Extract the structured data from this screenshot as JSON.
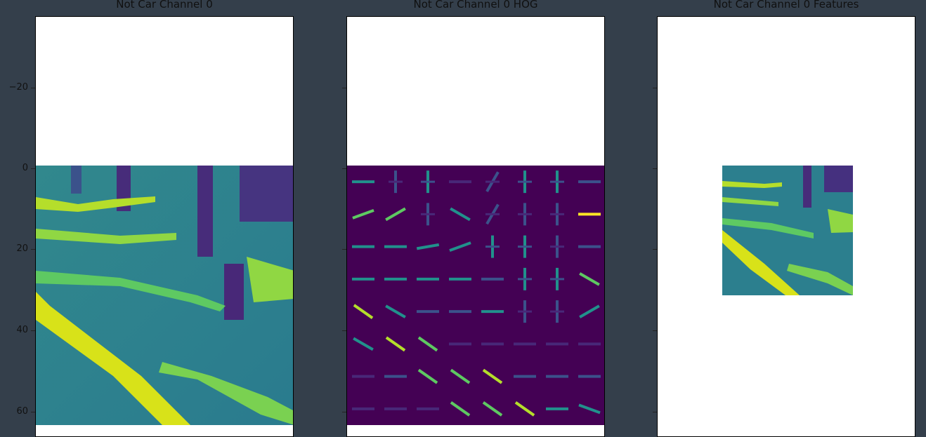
{
  "chart_data": [
    {
      "type": "heatmap",
      "title": "Not Car Channel 0",
      "ylim": [
        -37,
        64
      ],
      "yticks": [
        -20,
        0,
        20,
        40,
        60
      ],
      "ytick_labels": [
        "−20",
        "0",
        "20",
        "40",
        "60"
      ],
      "image_rows": 64,
      "image_cols": 64,
      "colormap": "viridis"
    },
    {
      "type": "heatmap",
      "title": "Not Car Channel 0 HOG",
      "ylim": [
        -37,
        64
      ],
      "yticks": [
        -20,
        0,
        20,
        40,
        60
      ],
      "ytick_labels": [
        "",
        "",
        "",
        "",
        ""
      ],
      "image_rows": 64,
      "image_cols": 64,
      "cells": 8,
      "colormap": "viridis"
    },
    {
      "type": "heatmap",
      "title": "Not Car Channel 0 Features",
      "yticks": [
        -20,
        0,
        20,
        40,
        60
      ],
      "ytick_labels": [
        "",
        "",
        "",
        "",
        ""
      ],
      "image_rows": 32,
      "image_cols": 32,
      "colormap": "viridis"
    }
  ]
}
